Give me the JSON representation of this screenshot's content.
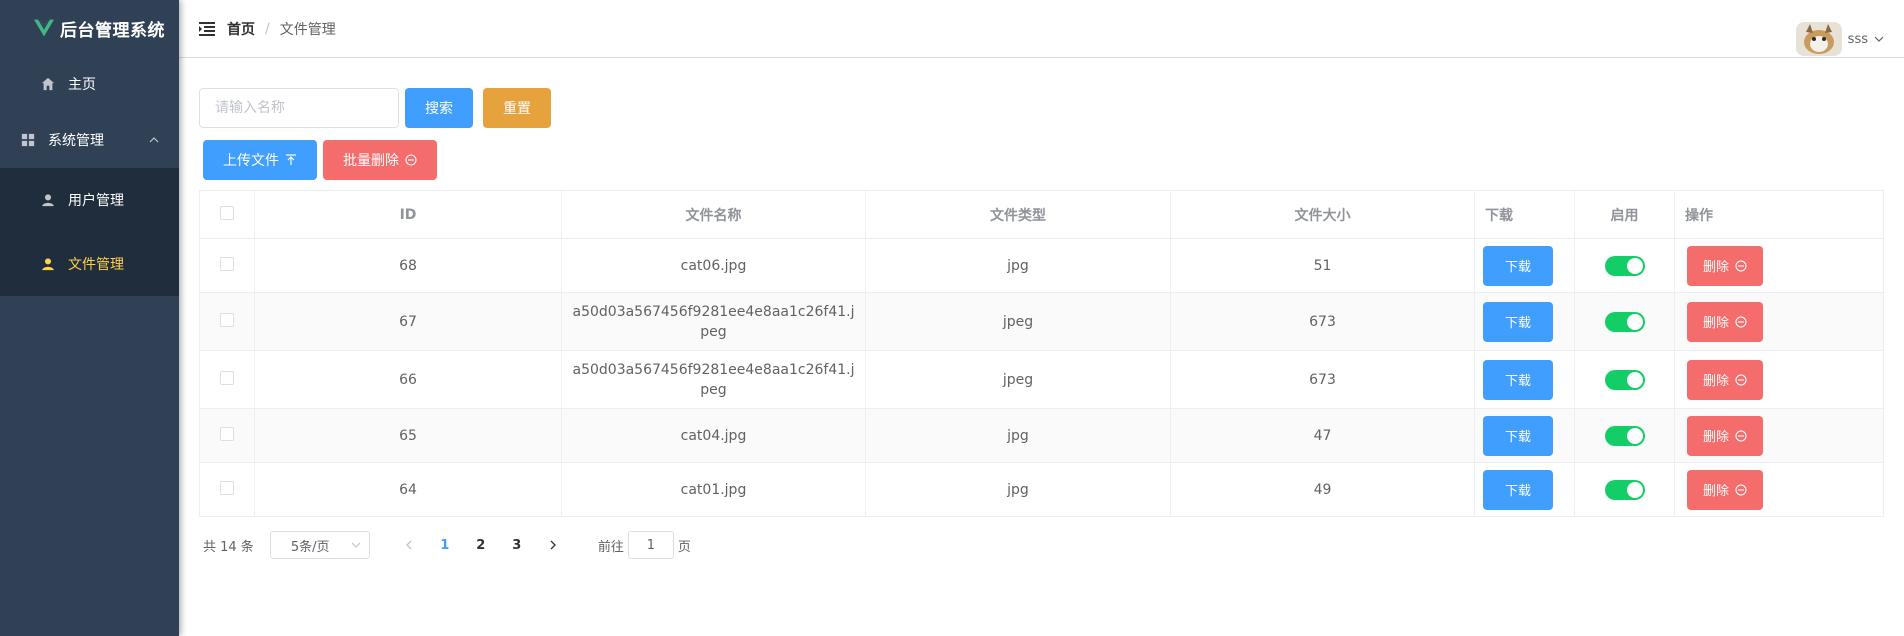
{
  "app": {
    "title": "后台管理系统"
  },
  "sidebar": {
    "items": [
      {
        "label": "主页",
        "icon": "home-icon"
      },
      {
        "label": "系统管理",
        "icon": "grid-icon"
      }
    ],
    "subitems": [
      {
        "label": "用户管理",
        "icon": "user-icon",
        "active": false
      },
      {
        "label": "文件管理",
        "icon": "user-icon",
        "active": true
      }
    ],
    "active_color": "#ffd04b",
    "bg_color": "#304156"
  },
  "header": {
    "breadcrumb": {
      "home": "首页",
      "separator": "/",
      "current": "文件管理"
    },
    "username": "sss"
  },
  "toolbar": {
    "search_placeholder": "请输入名称",
    "search_label": "搜索",
    "reset_label": "重置",
    "upload_label": "上传文件",
    "batch_delete_label": "批量删除"
  },
  "table": {
    "columns": [
      "ID",
      "文件名称",
      "文件类型",
      "文件大小",
      "下载",
      "启用",
      "操作"
    ],
    "download_label": "下载",
    "delete_label": "删除",
    "rows": [
      {
        "id": "68",
        "name": "cat06.jpg",
        "type": "jpg",
        "size": "51",
        "enabled": true
      },
      {
        "id": "67",
        "name": "a50d03a567456f9281ee4e8aa1c26f41.jpeg",
        "type": "jpeg",
        "size": "673",
        "enabled": true
      },
      {
        "id": "66",
        "name": "a50d03a567456f9281ee4e8aa1c26f41.jpeg",
        "type": "jpeg",
        "size": "673",
        "enabled": true
      },
      {
        "id": "65",
        "name": "cat04.jpg",
        "type": "jpg",
        "size": "47",
        "enabled": true
      },
      {
        "id": "64",
        "name": "cat01.jpg",
        "type": "jpg",
        "size": "49",
        "enabled": true
      }
    ]
  },
  "pagination": {
    "total": "共 14 条",
    "page_size": "5条/页",
    "pages": [
      "1",
      "2",
      "3"
    ],
    "current_page": "1",
    "goto_label": "前往",
    "goto_value": "1",
    "page_suffix": "页"
  },
  "colors": {
    "primary": "#409eff",
    "warning": "#e6a23c",
    "danger": "#f56c6c",
    "switch_on": "#13ce66"
  }
}
